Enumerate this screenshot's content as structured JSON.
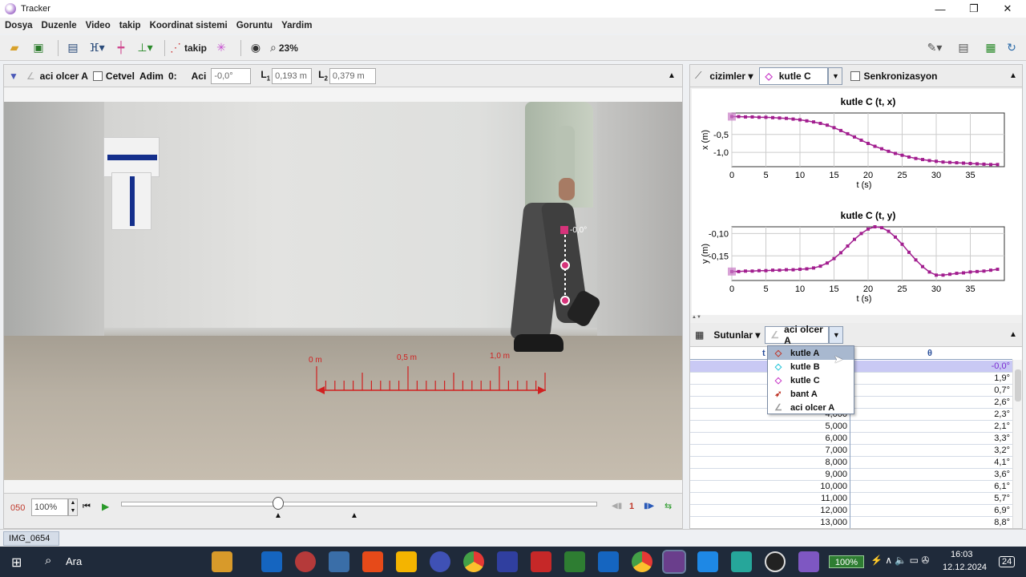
{
  "window": {
    "title": "Tracker",
    "minimize": "—",
    "maximize": "❐",
    "close": "✕"
  },
  "menu": [
    "Dosya",
    "Duzenle",
    "Video",
    "takip",
    "Koordinat sistemi",
    "Goruntu",
    "Yardim"
  ],
  "toolbar": {
    "track_label": "takip",
    "zoom_label": "23%"
  },
  "angle_bar": {
    "tool_name": "aci olcer A",
    "ruler_label": "Cetvel",
    "step_label": "Adim",
    "step_value": "0:",
    "angle_label": "Aci",
    "angle_value": "-0,0°",
    "l1_label": "L",
    "l1_sub": "1",
    "l1_value": "0,193 m",
    "l2_label": "L",
    "l2_sub": "2",
    "l2_value": "0,379 m"
  },
  "video": {
    "angle_readout": "-0,0°",
    "scale_labels": [
      "0 m",
      "0,5 m",
      "1,0 m"
    ]
  },
  "player": {
    "frame": "050",
    "rate": "100%",
    "step_size": "1",
    "progress": 0.33,
    "end_marker": 0.49
  },
  "plots": {
    "toolbar_label": "cizimler",
    "track_select": "kutle C",
    "sync_label": "Senkronizasyon"
  },
  "table_panel": {
    "columns_label": "Sutunlar",
    "track_select": "aci olcer A",
    "headers": [
      "t",
      "θ"
    ],
    "rows": [
      {
        "t": "",
        "theta": "-0,0°"
      },
      {
        "t": "",
        "theta": "1,9°"
      },
      {
        "t": "",
        "theta": "0,7°"
      },
      {
        "t": "",
        "theta": "2,6°"
      },
      {
        "t": "4,000",
        "theta": "2,3°"
      },
      {
        "t": "5,000",
        "theta": "2,1°"
      },
      {
        "t": "6,000",
        "theta": "3,3°"
      },
      {
        "t": "7,000",
        "theta": "3,2°"
      },
      {
        "t": "8,000",
        "theta": "4,1°"
      },
      {
        "t": "9,000",
        "theta": "3,6°"
      },
      {
        "t": "10,000",
        "theta": "6,1°"
      },
      {
        "t": "11,000",
        "theta": "5,7°"
      },
      {
        "t": "12,000",
        "theta": "6,9°"
      },
      {
        "t": "13,000",
        "theta": "8,8°"
      }
    ]
  },
  "track_dropdown": [
    {
      "label": "kutle A",
      "icon": "◇",
      "color": "#c0392b",
      "icon_name": "diamond-red-icon"
    },
    {
      "label": "kutle B",
      "icon": "◇",
      "color": "#26c6d9",
      "icon_name": "diamond-cyan-icon"
    },
    {
      "label": "kutle C",
      "icon": "◇",
      "color": "#c838c8",
      "icon_name": "diamond-magenta-icon"
    },
    {
      "label": "bant A",
      "icon": "➶",
      "color": "#c0392b",
      "icon_name": "tape-icon"
    },
    {
      "label": "aci olcer A",
      "icon": "∠",
      "color": "#999999",
      "icon_name": "protractor-icon"
    }
  ],
  "bottom_tab": "IMG_0654",
  "taskbar": {
    "search": "Ara",
    "battery": "100%",
    "time": "16:03",
    "date": "12.12.2024",
    "notifications": "24"
  },
  "chart_data": [
    {
      "type": "scatter",
      "title": "kutle C (t, x)",
      "xlabel": "t (s)",
      "ylabel": "x (m)",
      "xlim": [
        0,
        40
      ],
      "ylim": [
        -1.4,
        0.1
      ],
      "xticks": [
        "0",
        "5",
        "10",
        "15",
        "20",
        "25",
        "30",
        "35"
      ],
      "yticks": [
        "-0,5",
        "-1,0"
      ],
      "color": "#a21e8f",
      "x": [
        0,
        1,
        2,
        3,
        4,
        5,
        6,
        7,
        8,
        9,
        10,
        11,
        12,
        13,
        14,
        15,
        16,
        17,
        18,
        19,
        20,
        21,
        22,
        23,
        24,
        25,
        26,
        27,
        28,
        29,
        30,
        31,
        32,
        33,
        34,
        35,
        36,
        37,
        38,
        39
      ],
      "y": [
        0.0,
        0.0,
        -0.01,
        -0.01,
        -0.02,
        -0.02,
        -0.03,
        -0.04,
        -0.05,
        -0.07,
        -0.09,
        -0.12,
        -0.15,
        -0.19,
        -0.24,
        -0.31,
        -0.39,
        -0.48,
        -0.57,
        -0.66,
        -0.75,
        -0.83,
        -0.9,
        -0.97,
        -1.03,
        -1.08,
        -1.13,
        -1.17,
        -1.2,
        -1.23,
        -1.25,
        -1.27,
        -1.28,
        -1.29,
        -1.3,
        -1.31,
        -1.32,
        -1.33,
        -1.34,
        -1.34
      ]
    },
    {
      "type": "scatter",
      "title": "kutle C (t, y)",
      "xlabel": "t (s)",
      "ylabel": "y (m)",
      "xlim": [
        0,
        40
      ],
      "ylim": [
        -0.205,
        -0.085
      ],
      "xticks": [
        "0",
        "5",
        "10",
        "15",
        "20",
        "25",
        "30",
        "35"
      ],
      "yticks": [
        "-0,10",
        "-0,15"
      ],
      "color": "#a21e8f",
      "x": [
        0,
        1,
        2,
        3,
        4,
        5,
        6,
        7,
        8,
        9,
        10,
        11,
        12,
        13,
        14,
        15,
        16,
        17,
        18,
        19,
        20,
        21,
        22,
        23,
        24,
        25,
        26,
        27,
        28,
        29,
        30,
        31,
        32,
        33,
        34,
        35,
        36,
        37,
        38,
        39
      ],
      "y": [
        -0.185,
        -0.185,
        -0.184,
        -0.184,
        -0.183,
        -0.183,
        -0.182,
        -0.182,
        -0.181,
        -0.181,
        -0.18,
        -0.179,
        -0.177,
        -0.173,
        -0.166,
        -0.156,
        -0.143,
        -0.128,
        -0.113,
        -0.1,
        -0.09,
        -0.085,
        -0.087,
        -0.095,
        -0.108,
        -0.124,
        -0.142,
        -0.159,
        -0.174,
        -0.186,
        -0.193,
        -0.193,
        -0.191,
        -0.189,
        -0.188,
        -0.186,
        -0.185,
        -0.184,
        -0.182,
        -0.18
      ]
    }
  ]
}
